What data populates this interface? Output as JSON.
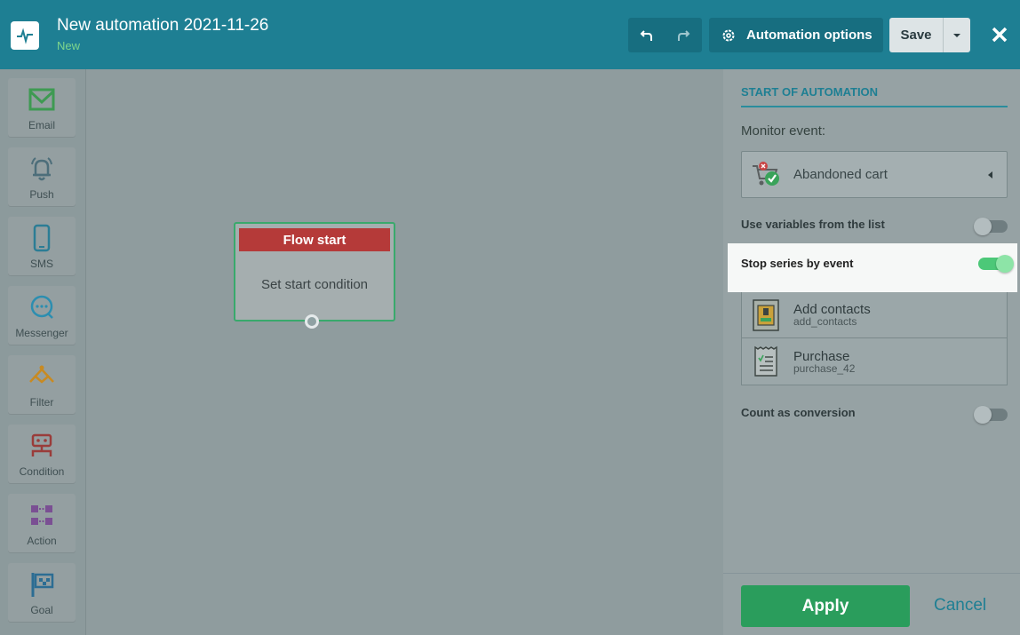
{
  "header": {
    "title": "New automation 2021-11-26",
    "status": "New",
    "options_label": "Automation options",
    "save_label": "Save",
    "undo_icon": "undo-icon",
    "redo_icon": "redo-icon",
    "close_icon": "close-icon"
  },
  "toolbar": {
    "items": [
      {
        "label": "Email",
        "icon": "envelope-icon",
        "color": "#3e9a52"
      },
      {
        "label": "Push",
        "icon": "bell-icon",
        "color": "#4d6e7a"
      },
      {
        "label": "SMS",
        "icon": "phone-icon",
        "color": "#2c7d95"
      },
      {
        "label": "Messenger",
        "icon": "chat-icon",
        "color": "#2c8eb0"
      },
      {
        "label": "Filter",
        "icon": "filter-icon",
        "color": "#c88a22"
      },
      {
        "label": "Condition",
        "icon": "condition-icon",
        "color": "#9a3c3a"
      },
      {
        "label": "Action",
        "icon": "action-icon",
        "color": "#7a4f93"
      },
      {
        "label": "Goal",
        "icon": "flag-icon",
        "color": "#2c6d93"
      }
    ]
  },
  "canvas": {
    "node_title": "Flow start",
    "node_body": "Set start condition"
  },
  "panel": {
    "title": "START OF AUTOMATION",
    "monitor_label": "Monitor event:",
    "monitor_value": "Abandoned cart",
    "use_variables_label": "Use variables from the list",
    "use_variables_on": false,
    "stop_series_label": "Stop series by event",
    "stop_series_on": true,
    "events": [
      {
        "name": "Add contacts",
        "code": "add_contacts",
        "icon": "add-contacts-icon"
      },
      {
        "name": "Purchase",
        "code": "purchase_42",
        "icon": "receipt-icon"
      }
    ],
    "count_conversion_label": "Count as conversion",
    "count_conversion_on": false,
    "apply_label": "Apply",
    "cancel_label": "Cancel"
  },
  "colors": {
    "header_bg": "#1e7f93",
    "accent_green": "#2a9d5c",
    "node_header": "#b53a39"
  }
}
